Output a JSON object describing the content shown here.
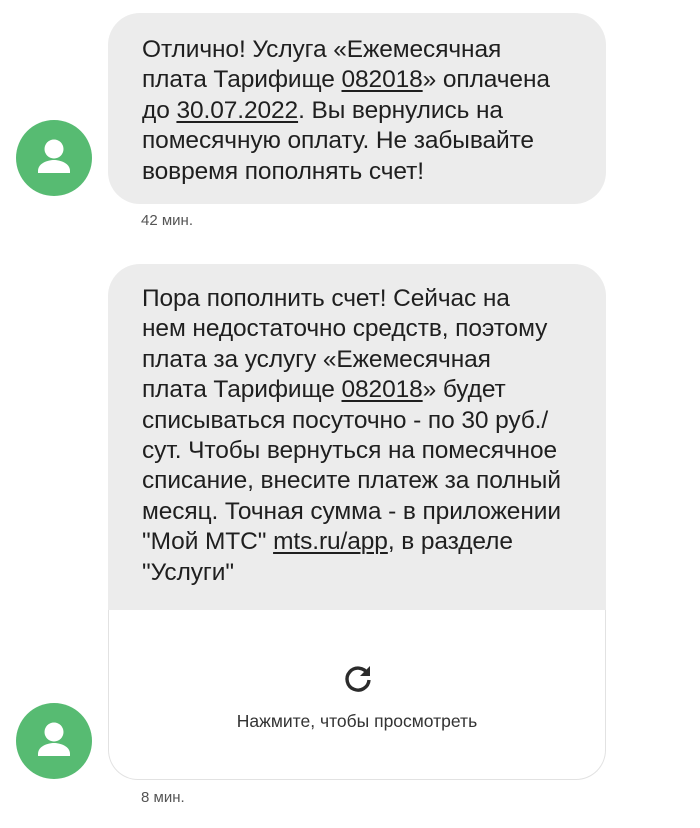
{
  "messages": [
    {
      "parts": [
        {
          "text": "Отлично! Услуга «Ежемесячная\nплата Тарифище ",
          "link": false
        },
        {
          "text": "082018",
          "link": true
        },
        {
          "text": "» оплачена\nдо ",
          "link": false
        },
        {
          "text": "30.07.2022",
          "link": true
        },
        {
          "text": ". Вы вернулись на\nпомесячную оплату. Не забывайте\nвовремя пополнять счет!",
          "link": false
        }
      ],
      "time": "42 мин."
    },
    {
      "parts": [
        {
          "text": "Пора пополнить счет! Сейчас на\nнем недостаточно средств, поэтому\nплата за услугу «Ежемесячная\nплата Тарифище ",
          "link": false
        },
        {
          "text": "082018",
          "link": true
        },
        {
          "text": "» будет\nсписываться посуточно - по 30 руб./\nсут. Чтобы вернуться на помесячное\nсписание, внесите платеж за полный\nмесяц. Точная сумма - в приложении\n\"Мой МТС\" ",
          "link": false
        },
        {
          "text": "mts.ru/app",
          "link": true
        },
        {
          "text": ", в разделе\n\"Услуги\"",
          "link": false
        }
      ],
      "time": "8 мин."
    }
  ],
  "preview": {
    "label": "Нажмите, чтобы просмотреть",
    "icon": "refresh-icon"
  },
  "colors": {
    "avatar": "#57bb72",
    "bubble": "#ececec"
  }
}
